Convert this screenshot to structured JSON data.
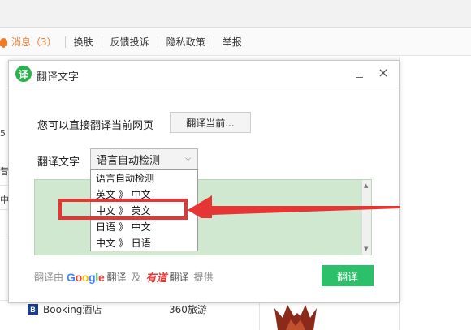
{
  "navbar": {
    "messages": "消息（3）",
    "items": [
      "换肤",
      "反馈投诉",
      "隐私政策",
      "举报"
    ]
  },
  "background": {
    "fragments": [
      "5",
      "昔",
      "中"
    ],
    "booking": "Booking酒店",
    "travel": "360旅游"
  },
  "dialog": {
    "logo": "译",
    "title": "翻译文字",
    "close": "×",
    "row1_label": "您可以直接翻译当前网页",
    "row1_button": "翻译当前...",
    "row2_label": "翻译文字",
    "select_value": "语言自动检测",
    "dropdown": [
      "语言自动检测",
      "英文 》 中文",
      "中文 》 英文",
      "日语 》 中文",
      "中文 》 日语"
    ],
    "provided": {
      "prefix": "翻译由",
      "google_suffix": "翻译",
      "and": "及",
      "youdao": "有道",
      "youdao_suffix": "翻译",
      "suffix": "提供"
    },
    "translate_button": "翻译"
  },
  "colors": {
    "accent_green": "#2bc069",
    "textarea_bg": "#cfe8cf",
    "highlight_red": "#e53535",
    "message_orange": "#e07a2f"
  }
}
